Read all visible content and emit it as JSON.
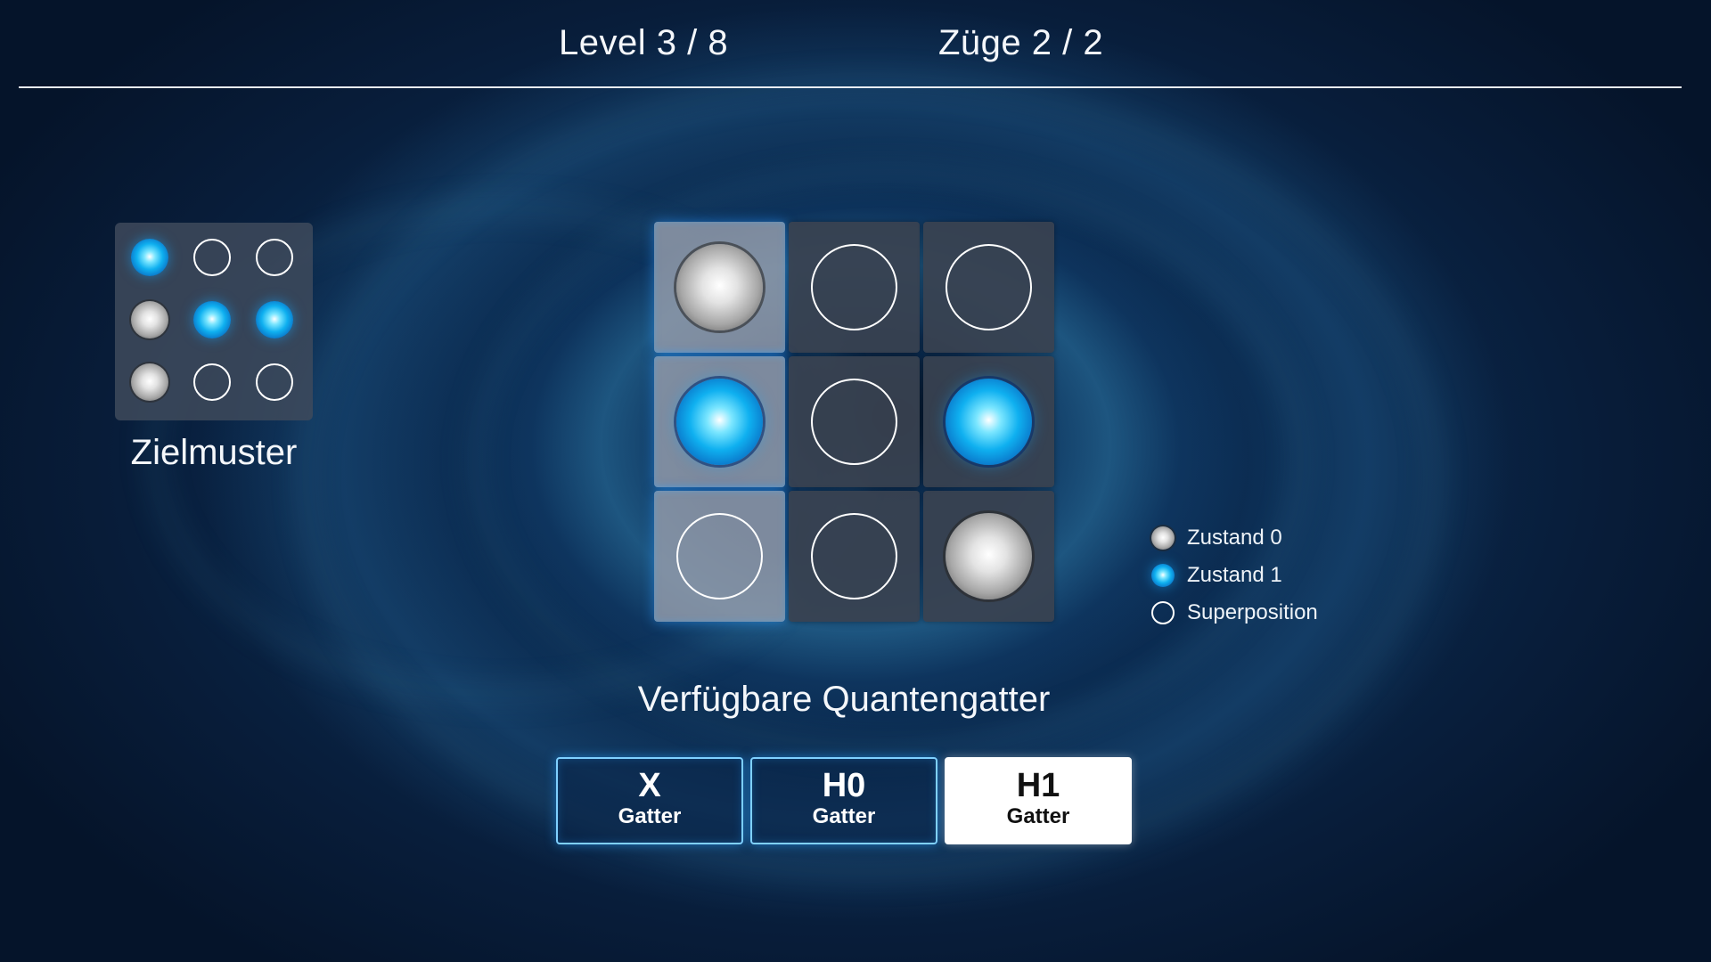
{
  "header": {
    "level": "Level 3 / 8",
    "moves": "Züge 2 / 2"
  },
  "target": {
    "title": "Zielmuster",
    "grid": [
      [
        "1",
        "S",
        "S"
      ],
      [
        "0",
        "1",
        "1"
      ],
      [
        "0",
        "S",
        "S"
      ]
    ]
  },
  "board": {
    "grid": [
      [
        "0",
        "S",
        "S"
      ],
      [
        "1",
        "S",
        "1"
      ],
      [
        "S",
        "S",
        "0"
      ]
    ],
    "selected_column": 1
  },
  "legend": [
    {
      "state": "0",
      "label": "Zustand 0"
    },
    {
      "state": "1",
      "label": "Zustand 1"
    },
    {
      "state": "S",
      "label": "Superposition"
    }
  ],
  "gates": {
    "title": "Verfügbare Quantengatter",
    "items": [
      {
        "name": "X",
        "sub": "Gatter",
        "active": false
      },
      {
        "name": "H0",
        "sub": "Gatter",
        "active": false
      },
      {
        "name": "H1",
        "sub": "Gatter",
        "active": true
      }
    ]
  },
  "colors": {
    "state1": "#0fb0f0",
    "state0": "#c8c8c8",
    "accent": "#7fd0ff"
  }
}
